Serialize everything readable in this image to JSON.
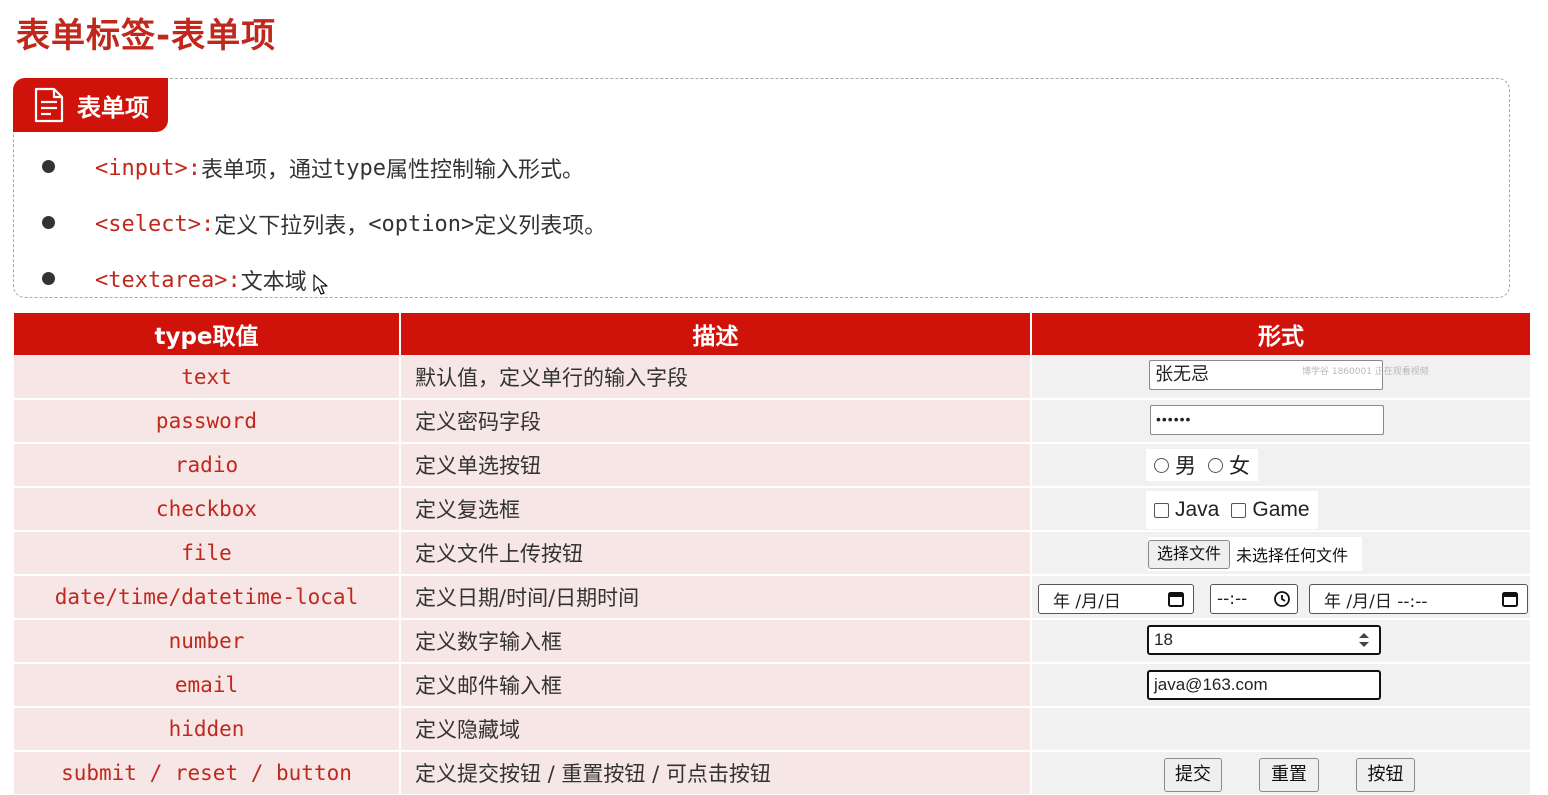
{
  "page": {
    "title": "表单标签-表单项"
  },
  "card": {
    "tag_label": "表单项",
    "bullets": [
      {
        "tag": "<input>:",
        "desc": " 表单项，通过",
        "mono": "type",
        "desc2": "属性控制输入形式。"
      },
      {
        "tag": "<select>:",
        "desc": " 定义下拉列表，",
        "mono": "<option>",
        "desc2": " 定义列表项。"
      },
      {
        "tag": "<textarea>:",
        "desc": " 文本域",
        "mono": "",
        "desc2": ""
      }
    ]
  },
  "table": {
    "headers": [
      "type取值",
      "描述",
      "形式"
    ],
    "rows": [
      {
        "type": "text",
        "desc": "默认值，定义单行的输入字段"
      },
      {
        "type": "password",
        "desc": "定义密码字段"
      },
      {
        "type": "radio",
        "desc": "定义单选按钮"
      },
      {
        "type": "checkbox",
        "desc": "定义复选框"
      },
      {
        "type": "file",
        "desc": "定义文件上传按钮"
      },
      {
        "type": "date/time/datetime-local",
        "desc": "定义日期/时间/日期时间"
      },
      {
        "type": "number",
        "desc": "定义数字输入框"
      },
      {
        "type": "email",
        "desc": "定义邮件输入框"
      },
      {
        "type": "hidden",
        "desc": "定义隐藏域"
      },
      {
        "type": "submit / reset / button",
        "desc": "定义提交按钮 / 重置按钮 / 可点击按钮"
      }
    ]
  },
  "demo": {
    "text_value": "张无忌",
    "watermark": "博学谷 1860001 正在观看视频",
    "password_mask": "••••••",
    "radio_options": [
      "男",
      "女"
    ],
    "checkbox_options": [
      "Java",
      "Game"
    ],
    "file_button": "选择文件",
    "file_status": "未选择任何文件",
    "date_placeholder": "年 /月/日",
    "time_placeholder": "--:--",
    "datetime_placeholder": "年 /月/日 --:--",
    "number_value": "18",
    "email_value": "java@163.com",
    "submit_label": "提交",
    "reset_label": "重置",
    "button_label": "按钮"
  },
  "colors": {
    "accent": "#d0130a",
    "tag_text": "#c0281d",
    "row_pink": "#f7e6e6",
    "row_gray": "#f1f1f1"
  }
}
